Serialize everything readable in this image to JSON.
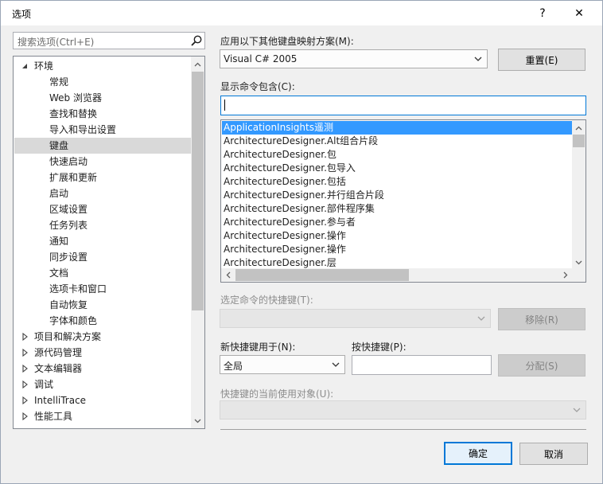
{
  "window": {
    "title": "选项",
    "help": "?",
    "close": "✕"
  },
  "search": {
    "placeholder": "搜索选项(Ctrl+E)"
  },
  "tree": {
    "items": [
      {
        "label": "环境",
        "expanded": true,
        "level": 0
      },
      {
        "label": "常规",
        "level": 1
      },
      {
        "label": "Web 浏览器",
        "level": 1
      },
      {
        "label": "查找和替换",
        "level": 1
      },
      {
        "label": "导入和导出设置",
        "level": 1
      },
      {
        "label": "键盘",
        "level": 1,
        "selected": true
      },
      {
        "label": "快速启动",
        "level": 1
      },
      {
        "label": "扩展和更新",
        "level": 1
      },
      {
        "label": "启动",
        "level": 1
      },
      {
        "label": "区域设置",
        "level": 1
      },
      {
        "label": "任务列表",
        "level": 1
      },
      {
        "label": "通知",
        "level": 1
      },
      {
        "label": "同步设置",
        "level": 1
      },
      {
        "label": "文档",
        "level": 1
      },
      {
        "label": "选项卡和窗口",
        "level": 1
      },
      {
        "label": "自动恢复",
        "level": 1
      },
      {
        "label": "字体和颜色",
        "level": 1
      },
      {
        "label": "项目和解决方案",
        "expanded": false,
        "level": 0
      },
      {
        "label": "源代码管理",
        "expanded": false,
        "level": 0
      },
      {
        "label": "文本编辑器",
        "expanded": false,
        "level": 0
      },
      {
        "label": "调试",
        "expanded": false,
        "level": 0
      },
      {
        "label": "IntelliTrace",
        "expanded": false,
        "level": 0
      },
      {
        "label": "性能工具",
        "expanded": false,
        "level": 0
      }
    ]
  },
  "mapping": {
    "label": "应用以下其他键盘映射方案(M):",
    "value": "Visual C# 2005",
    "reset_button": "重置(E)"
  },
  "commands": {
    "label": "显示命令包含(C):",
    "filter_value": "",
    "items": [
      "ApplicationInsights遥测",
      "ArchitectureDesigner.Alt组合片段",
      "ArchitectureDesigner.包",
      "ArchitectureDesigner.包导入",
      "ArchitectureDesigner.包括",
      "ArchitectureDesigner.并行组合片段",
      "ArchitectureDesigner.部件程序集",
      "ArchitectureDesigner.参与者",
      "ArchitectureDesigner.操作",
      "ArchitectureDesigner.操作",
      "ArchitectureDesigner.层"
    ],
    "selected_index": 0
  },
  "shortcuts": {
    "label": "选定命令的快捷键(T):",
    "remove_button": "移除(R)"
  },
  "new_shortcut": {
    "use_in_label": "新快捷键用于(N):",
    "use_in_value": "全局",
    "press_label": "按快捷键(P):",
    "press_value": "",
    "assign_button": "分配(S)"
  },
  "current_use": {
    "label": "快捷键的当前使用对象(U):"
  },
  "footer": {
    "ok": "确定",
    "cancel": "取消"
  }
}
